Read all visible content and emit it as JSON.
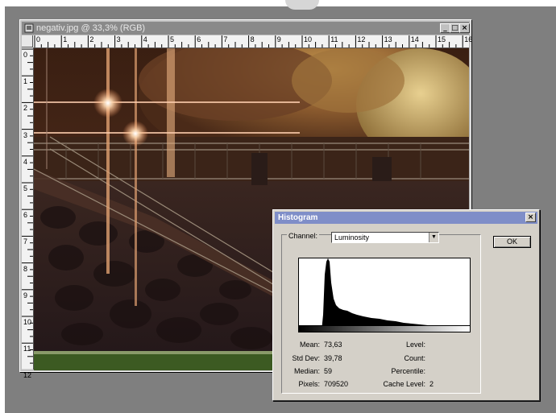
{
  "image_window": {
    "title": "negativ.jpg @ 33,3% (RGB)",
    "btn_minimize": "_",
    "btn_maximize": "□",
    "btn_close": "×",
    "ruler_top_numbers": [
      "0",
      "1",
      "2",
      "3",
      "4",
      "5",
      "6",
      "7",
      "8",
      "9",
      "10",
      "11",
      "12",
      "13",
      "14",
      "15",
      "16"
    ],
    "ruler_left_numbers": [
      "0",
      "1",
      "2",
      "3",
      "4",
      "5",
      "6",
      "7",
      "8",
      "9",
      "10",
      "11",
      "12"
    ]
  },
  "histogram_dialog": {
    "title": "Histogram",
    "close_label": "×",
    "channel_label": "Channel:",
    "channel_value": "Luminosity",
    "ok_label": "OK",
    "stats_left": [
      {
        "label": "Mean:",
        "value": "73,63"
      },
      {
        "label": "Std Dev:",
        "value": "39,78"
      },
      {
        "label": "Median:",
        "value": "59"
      },
      {
        "label": "Pixels:",
        "value": "709520"
      }
    ],
    "stats_right": [
      {
        "label": "Level:",
        "value": ""
      },
      {
        "label": "Count:",
        "value": ""
      },
      {
        "label": "Percentile:",
        "value": ""
      },
      {
        "label": "Cache Level:",
        "value": "2"
      }
    ]
  },
  "colors": {
    "desktop": "#7f7f7f",
    "dialog_title": "#7f8ec8",
    "image_title": "#8a8a8a"
  }
}
